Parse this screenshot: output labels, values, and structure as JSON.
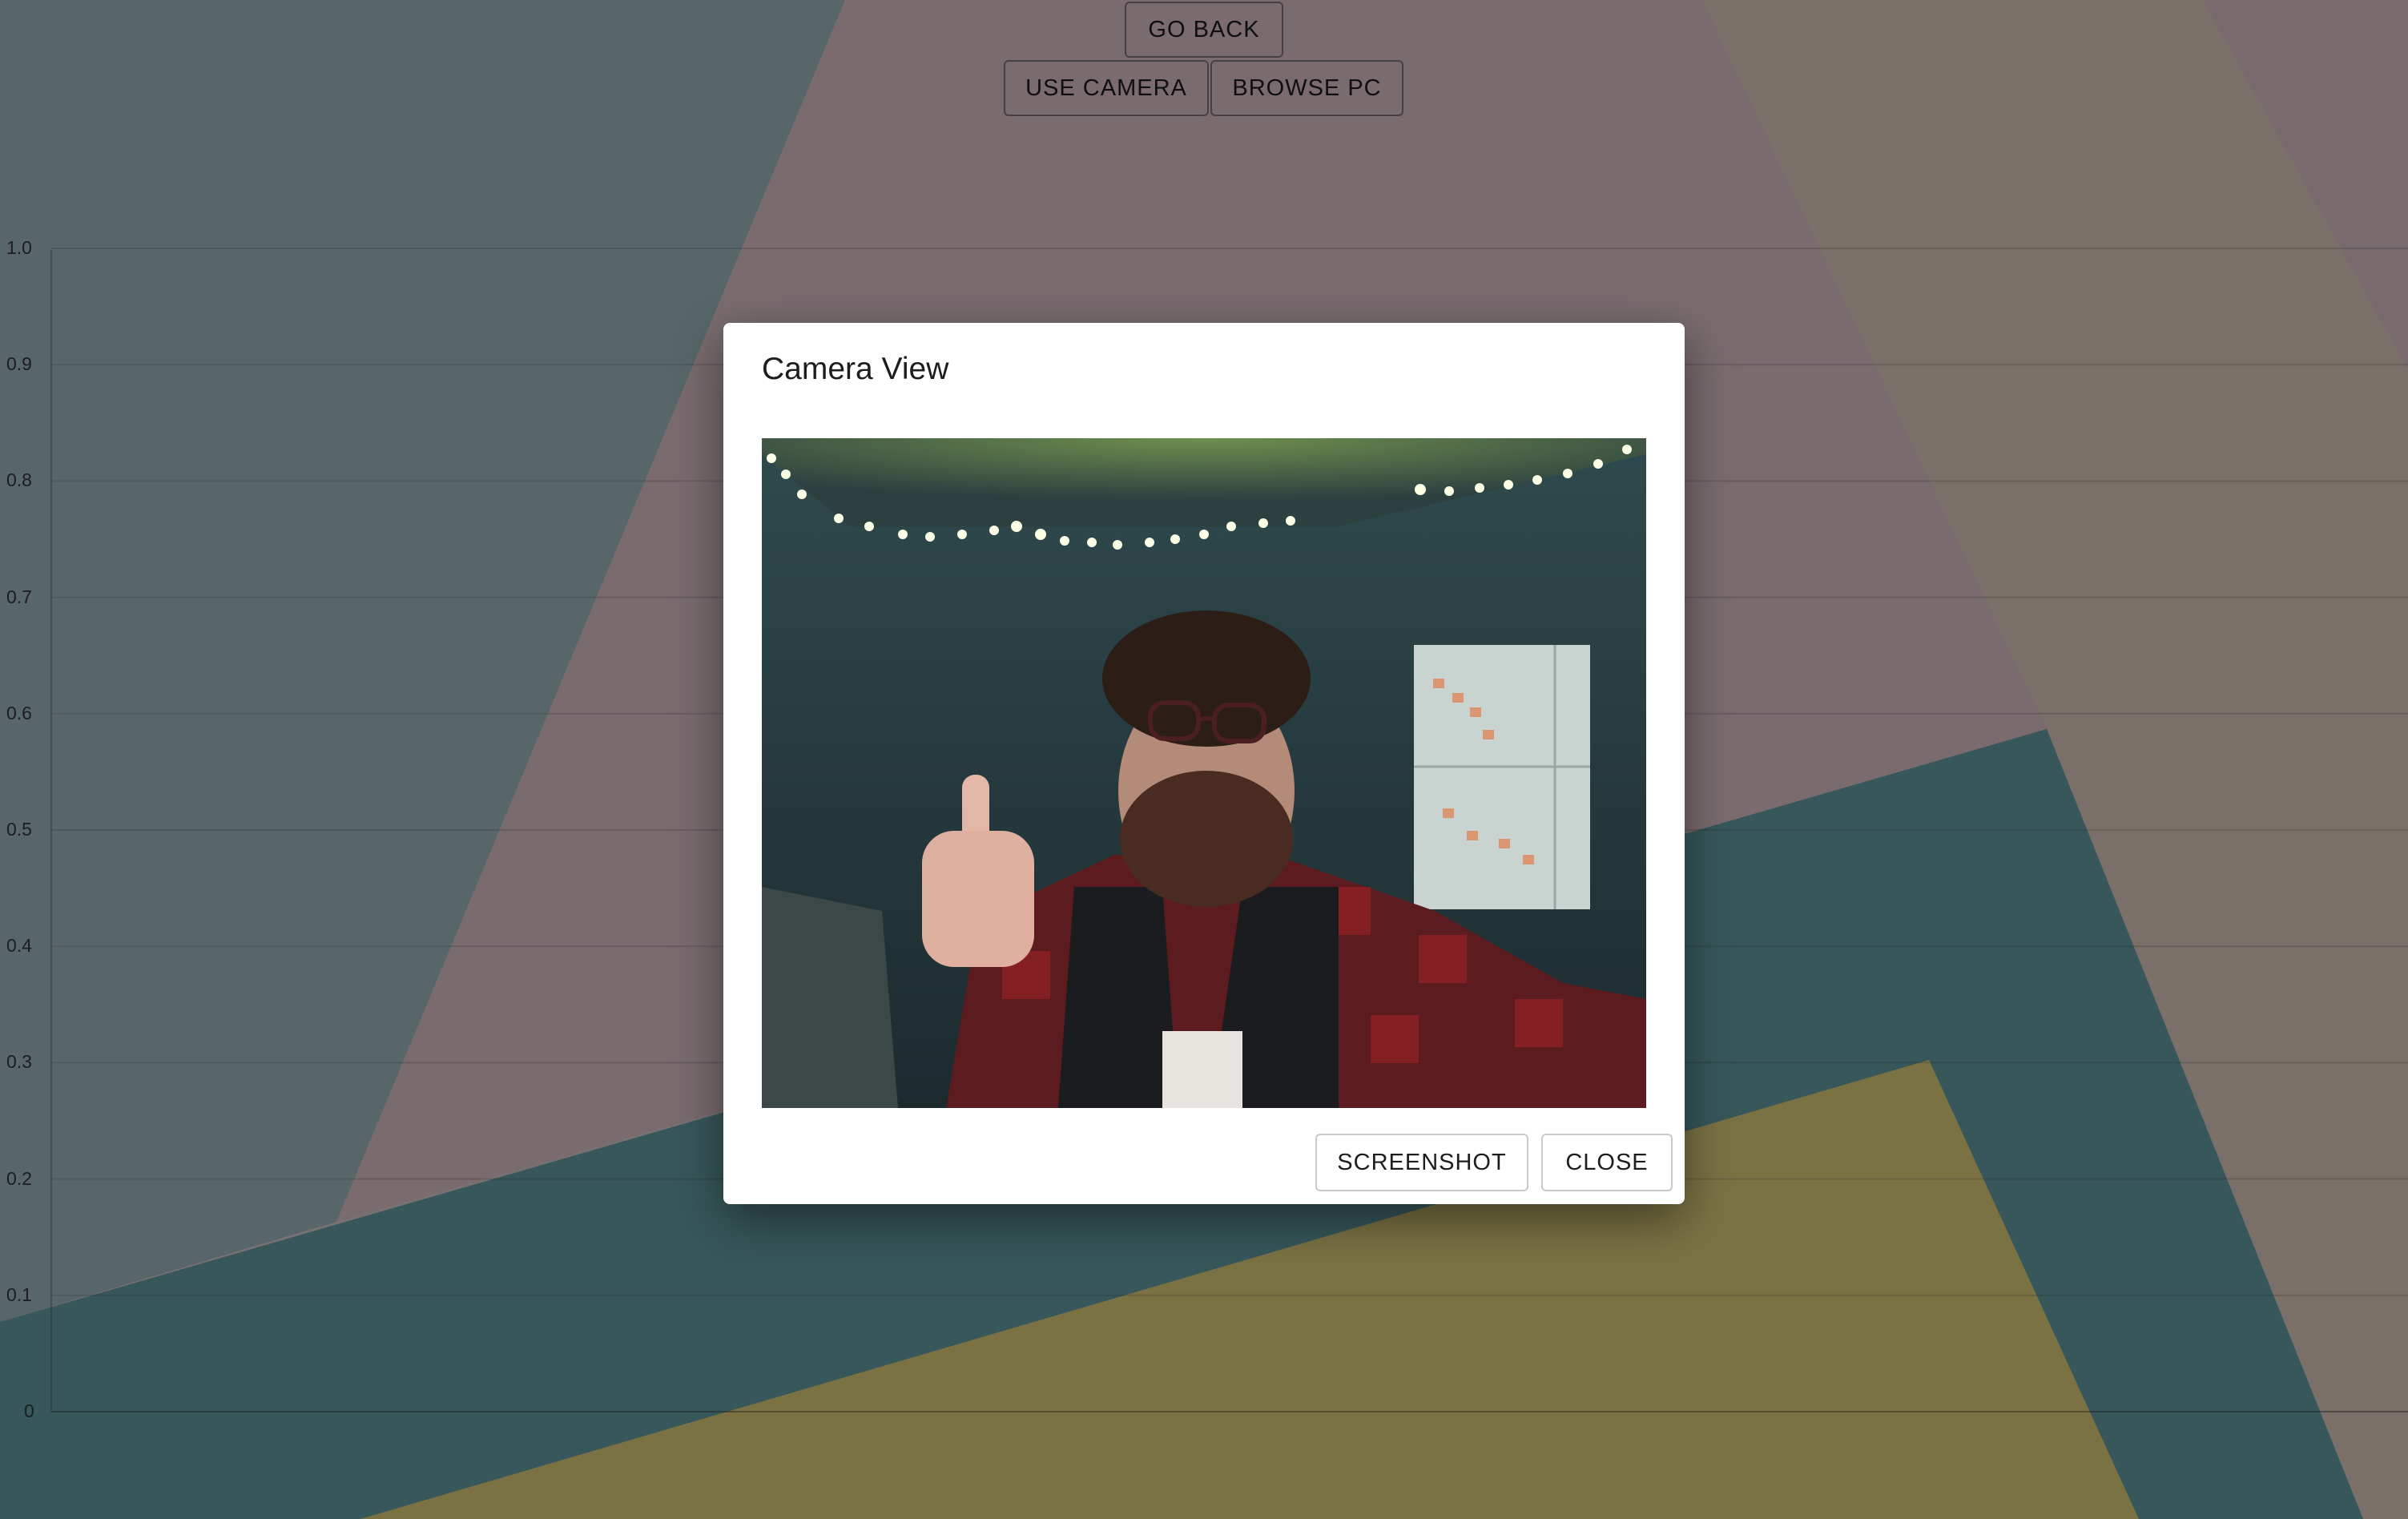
{
  "toolbar": {
    "go_back_label": "GO BACK",
    "use_camera_label": "USE CAMERA",
    "browse_pc_label": "BROWSE PC"
  },
  "background_chart": {
    "y_ticks": [
      "1.0",
      "0.9",
      "0.8",
      "0.7",
      "0.6",
      "0.5",
      "0.4",
      "0.3",
      "0.2",
      "0.1",
      "0"
    ],
    "colors": {
      "teal_left": "#b1cdd3",
      "pink": "#f3d6dd",
      "tan": "#f5ded3",
      "dark_teal": "#6eaeb4",
      "yellow": "#f6e489"
    }
  },
  "dialog": {
    "title": "Camera View",
    "screenshot_label": "SCREENSHOT",
    "close_label": "CLOSE"
  }
}
